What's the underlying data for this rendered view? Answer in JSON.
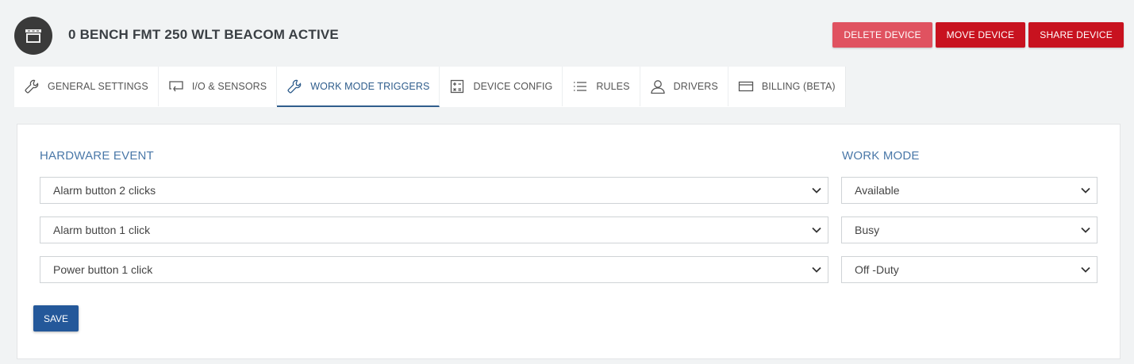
{
  "device": {
    "title": "0 BENCH FMT 250 WLT BEACOM ACTIVE"
  },
  "actions": {
    "delete_label": "DELETE DEVICE",
    "move_label": "MOVE DEVICE",
    "share_label": "SHARE DEVICE"
  },
  "tabs": [
    {
      "label": "GENERAL SETTINGS",
      "icon": "wrench-icon"
    },
    {
      "label": "I/O & SENSORS",
      "icon": "monitor-icon"
    },
    {
      "label": "WORK MODE TRIGGERS",
      "icon": "wrench-icon",
      "active": true
    },
    {
      "label": "DEVICE CONFIG",
      "icon": "calculator-icon"
    },
    {
      "label": "RULES",
      "icon": "list-icon"
    },
    {
      "label": "DRIVERS",
      "icon": "user-icon"
    },
    {
      "label": "BILLING (BETA)",
      "icon": "credit-card-icon"
    }
  ],
  "form": {
    "hardware_event_heading": "HARDWARE EVENT",
    "work_mode_heading": "WORK MODE",
    "rows": [
      {
        "event": "Alarm button 2 clicks",
        "mode": "Available"
      },
      {
        "event": "Alarm button 1 click",
        "mode": "Busy"
      },
      {
        "event": "Power button 1 click",
        "mode": "Off -Duty"
      }
    ],
    "save_label": "SAVE"
  },
  "colors": {
    "accent": "#2f5d8c",
    "danger_light": "#e05260",
    "danger": "#c8121f",
    "primary_button": "#24589a"
  }
}
